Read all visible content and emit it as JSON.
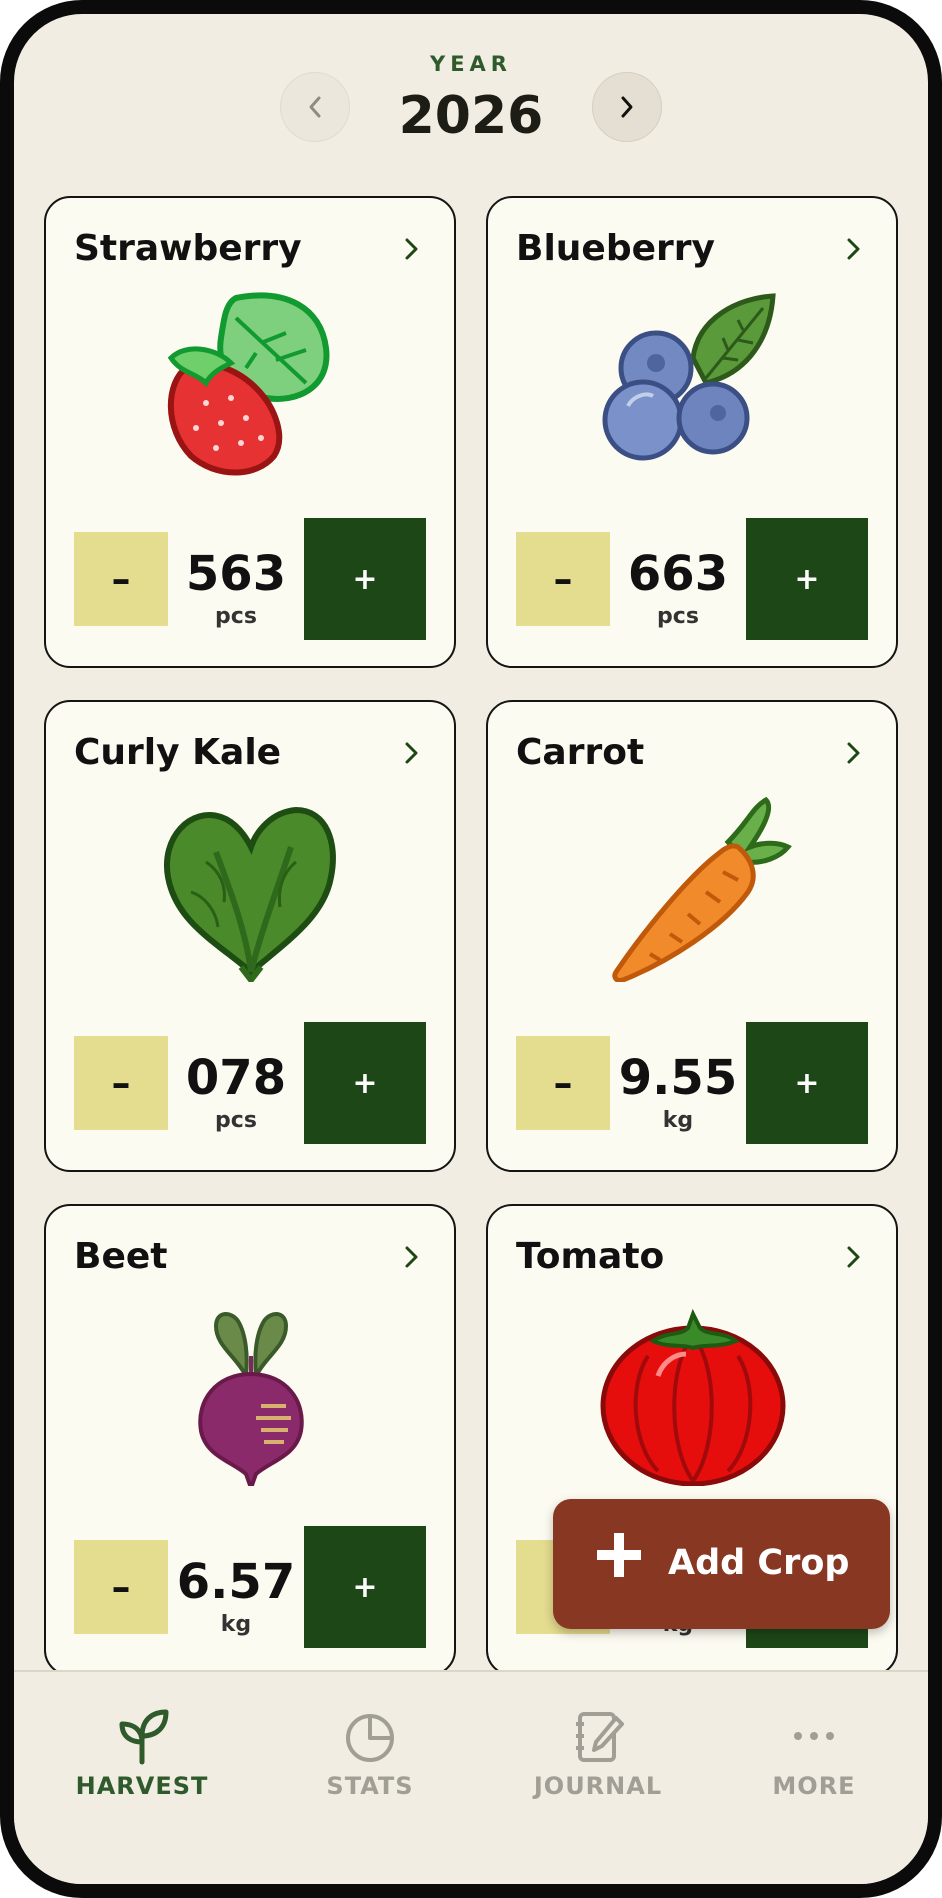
{
  "header": {
    "year_label": "YEAR",
    "year": "2026",
    "prev_icon": "chevron-left-icon",
    "next_icon": "chevron-right-icon"
  },
  "crops": [
    {
      "name": "Strawberry",
      "value": "563",
      "unit": "pcs",
      "icon": "strawberry-icon"
    },
    {
      "name": "Blueberry",
      "value": "663",
      "unit": "pcs",
      "icon": "blueberry-icon"
    },
    {
      "name": "Curly Kale",
      "value": "078",
      "unit": "pcs",
      "icon": "kale-icon"
    },
    {
      "name": "Carrot",
      "value": "9.55",
      "unit": "kg",
      "icon": "carrot-icon"
    },
    {
      "name": "Beet",
      "value": "6.57",
      "unit": "kg",
      "icon": "beet-icon"
    },
    {
      "name": "Tomato",
      "value": "",
      "unit": "kg",
      "icon": "tomato-icon"
    }
  ],
  "controls": {
    "minus_label": "–",
    "plus_label": "+"
  },
  "fab": {
    "label": "Add Crop",
    "icon": "plus-icon"
  },
  "tabs": [
    {
      "label": "HARVEST",
      "icon": "sprout-icon",
      "active": true
    },
    {
      "label": "STATS",
      "icon": "pie-chart-icon",
      "active": false
    },
    {
      "label": "JOURNAL",
      "icon": "notebook-pen-icon",
      "active": false
    },
    {
      "label": "MORE",
      "icon": "more-dots-icon",
      "active": false
    }
  ],
  "colors": {
    "background": "#f2ede2",
    "card": "#fcfbf1",
    "accent_green": "#1d4716",
    "minus_yellow": "#e4dc8e",
    "fab": "#883722",
    "tab_active": "#2f5a2b",
    "tab_inactive": "#a19e95"
  }
}
